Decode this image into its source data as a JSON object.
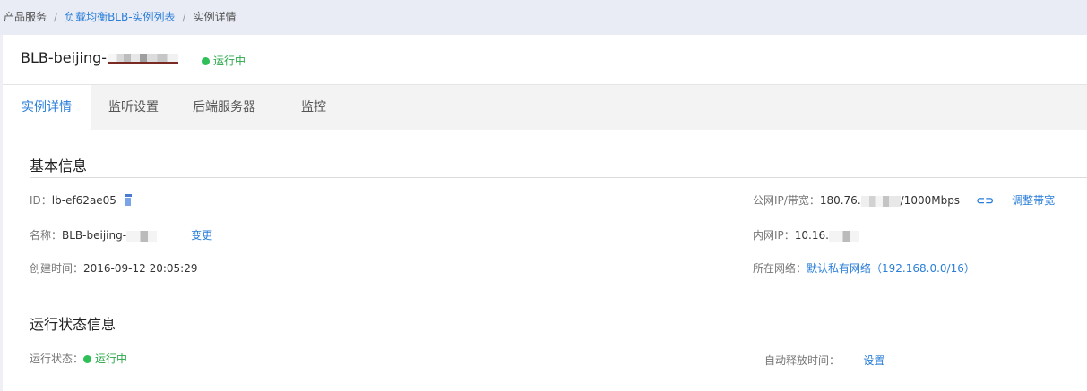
{
  "breadcrumb": {
    "root": "产品服务",
    "separator": "/",
    "list": "负载均衡BLB-实例列表",
    "current": "实例详情"
  },
  "instance": {
    "title": "BLB-beijing-",
    "status": "运行中"
  },
  "tabs": [
    "实例详情",
    "监听设置",
    "后端服务器",
    "监控"
  ],
  "basic": {
    "title": "基本信息",
    "id_label": "ID：",
    "id_value": "lb-ef62ae05",
    "name_label": "名称：",
    "name_value": "BLB-beijing-",
    "name_change": "变更",
    "created_label": "创建时间：",
    "created_value": "2016-09-12 20:05:29",
    "public_label": "公网IP/带宽：",
    "public_ip_prefix": "180.76.",
    "public_bandwidth": "/1000Mbps",
    "adjust_bandwidth": "调整带宽",
    "internal_label": "内网IP：",
    "internal_ip_prefix": "10.16.",
    "network_label": "所在网络：",
    "network_value": "默认私有网络（192.168.0.0/16）"
  },
  "run": {
    "title": "运行状态信息",
    "status_label": "运行状态：",
    "status_value": "运行中",
    "release_label": "自动释放时间：",
    "release_value": "-",
    "release_set": "设置"
  },
  "colors": {
    "accent": "#2a7ed8",
    "running": "#2ebf57"
  },
  "icons": {
    "copy": "copy-icon",
    "link": "link-icon",
    "status": "status-dot-icon"
  }
}
